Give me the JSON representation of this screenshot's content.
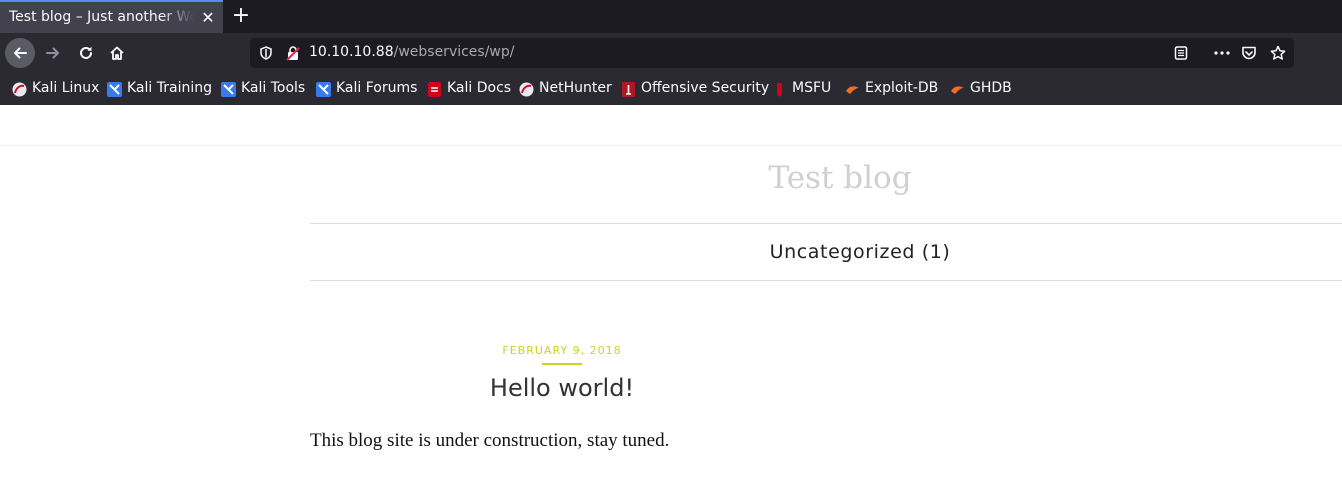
{
  "browser": {
    "tab": {
      "title": "Test blog – Just another WordPress site",
      "close_glyph": "✕"
    },
    "new_tab_glyph": "+",
    "url": {
      "host": "10.10.10.88",
      "path": "/webservices/wp/"
    },
    "bookmarks": [
      {
        "label": "Kali Linux",
        "icon": "kali-dragon-icon"
      },
      {
        "label": "Kali Training",
        "icon": "kali-training-icon"
      },
      {
        "label": "Kali Tools",
        "icon": "kali-tools-icon"
      },
      {
        "label": "Kali Forums",
        "icon": "kali-forums-icon"
      },
      {
        "label": "Kali Docs",
        "icon": "kali-docs-icon"
      },
      {
        "label": "NetHunter",
        "icon": "nethunter-icon"
      },
      {
        "label": "Offensive Security",
        "icon": "offsec-icon"
      },
      {
        "label": "MSFU",
        "icon": "msfu-icon"
      },
      {
        "label": "Exploit-DB",
        "icon": "exploit-db-icon"
      },
      {
        "label": "GHDB",
        "icon": "ghdb-icon"
      }
    ],
    "colors": {
      "chrome": "#2b2a33",
      "tabbar": "#1c1b22",
      "accent": "#4f8ff7"
    }
  },
  "site": {
    "title": "Test blog",
    "menu_item": "Uncategorized",
    "menu_count": "(1)"
  },
  "post": {
    "date": "FEBRUARY 9, 2018",
    "title": "Hello world!",
    "body": "This blog site is under construction, stay tuned."
  },
  "colors": {
    "date_accent": "#c9d51a",
    "title_gray": "#d0d0d0"
  }
}
